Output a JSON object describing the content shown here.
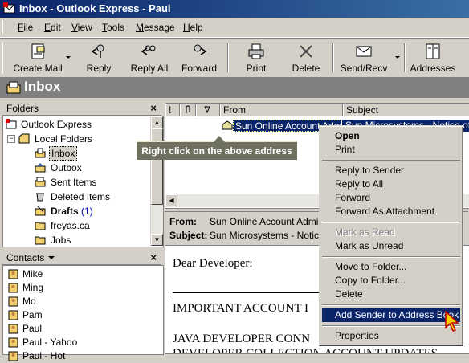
{
  "window": {
    "title": "Inbox - Outlook Express - Paul"
  },
  "menu": [
    "File",
    "Edit",
    "View",
    "Tools",
    "Message",
    "Help"
  ],
  "menu_underline": [
    "F",
    "E",
    "V",
    "T",
    "M",
    "H"
  ],
  "toolbar": {
    "create_mail": "Create Mail",
    "reply": "Reply",
    "reply_all": "Reply All",
    "forward": "Forward",
    "print": "Print",
    "delete": "Delete",
    "send_recv": "Send/Recv",
    "addresses": "Addresses"
  },
  "folder_bar": {
    "title": "Inbox"
  },
  "folders": {
    "header": "Folders",
    "close": "×",
    "items": [
      {
        "label": "Outlook Express",
        "icon": "outlook-express-icon"
      },
      {
        "label": "Local Folders",
        "icon": "local-folders-icon"
      },
      {
        "label": "Inbox",
        "icon": "inbox-icon"
      },
      {
        "label": "Outbox",
        "icon": "outbox-icon"
      },
      {
        "label": "Sent Items",
        "icon": "sent-items-icon"
      },
      {
        "label": "Deleted Items",
        "icon": "deleted-items-icon"
      },
      {
        "label": "Drafts",
        "count": "(1)",
        "icon": "drafts-icon"
      },
      {
        "label": "freyas.ca",
        "icon": "folder-icon"
      },
      {
        "label": "Jobs",
        "icon": "folder-icon"
      }
    ]
  },
  "contacts": {
    "header": "Contacts",
    "close": "×",
    "items": [
      "Mike",
      "Ming",
      "Mo",
      "Pam",
      "Paul",
      "Paul - Yahoo",
      "Paul - Hot"
    ]
  },
  "message_list": {
    "columns": {
      "priority": "!",
      "attachment": "",
      "flag": "",
      "from": "From",
      "subject": "Subject"
    },
    "selected": {
      "from": "Sun Online Account Admi",
      "subject": "Sun Microsystems - Notice of Im"
    }
  },
  "tooltip": "Right click on the above address",
  "preview": {
    "from_label": "From:",
    "from_value": "Sun Online Account Administrat",
    "subject_label": "Subject:",
    "subject_value": "Sun Microsystems - Notice of",
    "body": {
      "greeting": "Dear Developer:",
      "line1": "IMPORTANT ACCOUNT I",
      "line2": "JAVA DEVELOPER CONN",
      "line3": "DEVELOPER COLLECTION ACCOUNT UPDATES"
    }
  },
  "context_menu": {
    "open": "Open",
    "print": "Print",
    "reply_to_sender": "Reply to Sender",
    "reply_to_all": "Reply to All",
    "forward": "Forward",
    "forward_as_attachment": "Forward As Attachment",
    "mark_as_read": "Mark as Read",
    "mark_as_unread": "Mark as Unread",
    "move_to_folder": "Move to Folder...",
    "copy_to_folder": "Copy to Folder...",
    "delete": "Delete",
    "add_sender": "Add Sender to Address Book",
    "properties": "Properties"
  },
  "colors": {
    "selection": "#0a246a",
    "tooltip": "#707060",
    "window_bg": "#d4d0c8",
    "folder_bar": "#808080"
  }
}
